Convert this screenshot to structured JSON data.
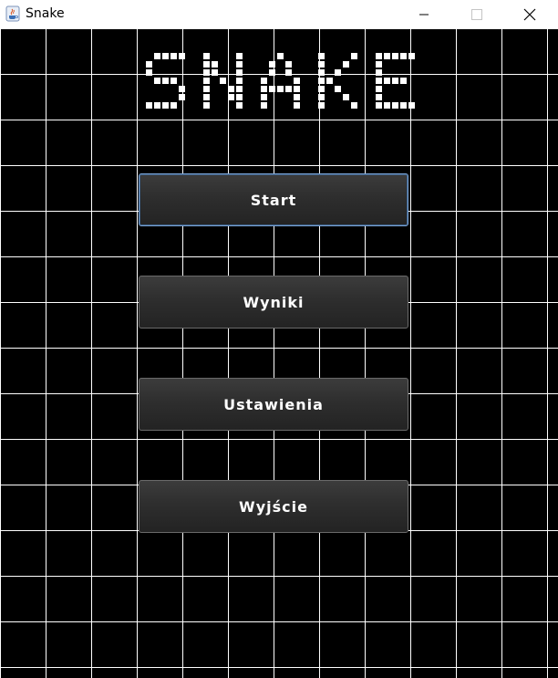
{
  "window": {
    "title": "Snake",
    "icon": "java-cup-icon",
    "controls": [
      "minimize-icon",
      "maximize-icon",
      "close-icon"
    ]
  },
  "logo": {
    "text": "SNAKE"
  },
  "menu": {
    "start_label": "Start",
    "results_label": "Wyniki",
    "settings_label": "Ustawienia",
    "exit_label": "Wyjście"
  },
  "colors": {
    "background": "#000000",
    "grid_line": "#ffffff",
    "logo_block": "#ffffff",
    "button_text": "#ffffff",
    "focus_border": "#7aa3d4"
  }
}
